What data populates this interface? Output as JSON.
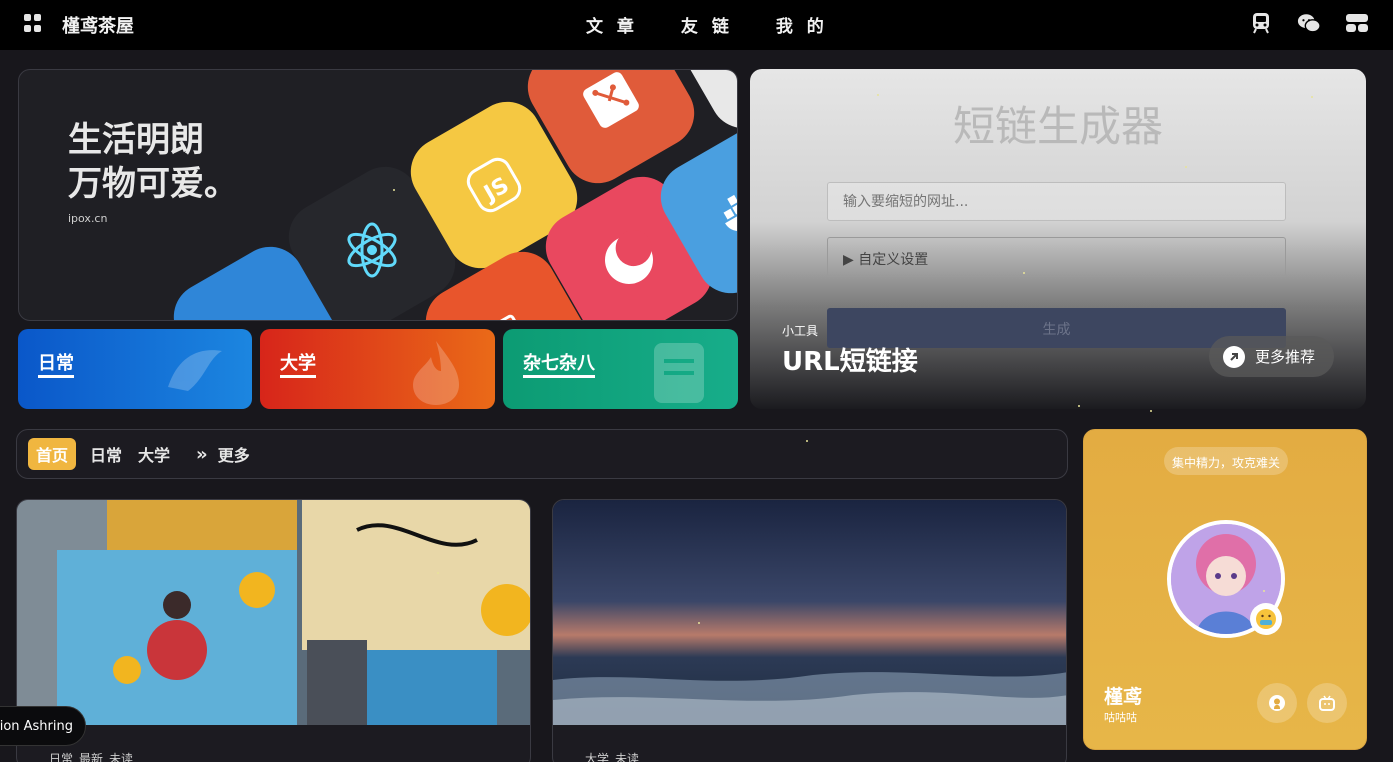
{
  "header": {
    "site_title": "槿鸢茶屋",
    "nav": [
      "文 章",
      "友 链",
      "我 的"
    ],
    "icons": [
      "menu-grid-icon",
      "train-icon",
      "wechat-icon",
      "toolbox-icon"
    ]
  },
  "hero": {
    "line1": "生活明朗",
    "line2": "万物可爱。",
    "domain": "ipox.cn",
    "tile_icons": [
      "react-icon",
      "javascript-icon",
      "git-icon",
      "docker-icon",
      "moon-app-icon",
      "html-icon"
    ]
  },
  "categories": [
    {
      "label": "日常",
      "color_from": "#0a57c9",
      "color_to": "#1c86e0"
    },
    {
      "label": "大学",
      "color_from": "#d7251a",
      "color_to": "#ea6a18"
    },
    {
      "label": "杂七杂八",
      "color_from": "#0c9b73",
      "color_to": "#17ad8a"
    }
  ],
  "tool": {
    "title": "短链生成器",
    "input_placeholder": "输入要缩短的网址...",
    "custom_settings": "▶ 自定义设置",
    "generate": "生成",
    "caption": "小工具",
    "name": "URL短链接",
    "more": "更多推荐"
  },
  "tabs": {
    "items": [
      "首页",
      "日常",
      "大学"
    ],
    "more": "更多",
    "active_color": "#f0b640"
  },
  "posts": [
    {
      "tags": [
        "日常",
        "最新",
        "未读"
      ]
    },
    {
      "tags": [
        "大学",
        "未读"
      ]
    }
  ],
  "profile": {
    "motto": "集中精力，攻克难关",
    "name": "槿鸢",
    "subtitle": "咕咕咕",
    "social_icons": [
      "github-icon",
      "bilibili-icon"
    ]
  },
  "music": {
    "text": "tion Ashring"
  }
}
